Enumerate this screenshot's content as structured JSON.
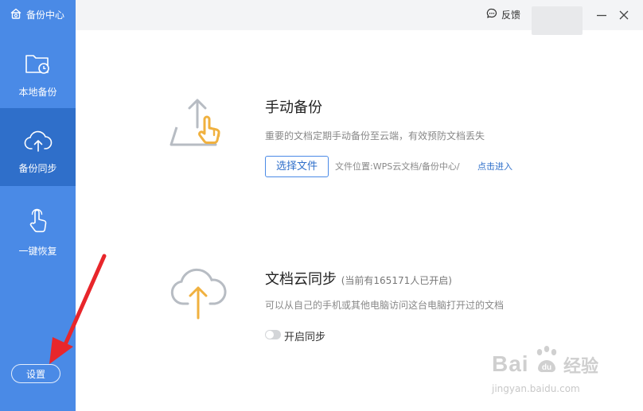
{
  "app": {
    "title": "备份中心"
  },
  "sidebar": {
    "items": [
      {
        "label": "本地备份",
        "icon": "folder-clock-icon"
      },
      {
        "label": "备份同步",
        "icon": "cloud-upload-icon",
        "active": true
      },
      {
        "label": "一键恢复",
        "icon": "hand-pointer-icon"
      }
    ],
    "settings_label": "设置"
  },
  "titlebar": {
    "feedback_label": "反馈"
  },
  "manual_backup": {
    "title": "手动备份",
    "description": "重要的文档定期手动备份至云端，有效预防文档丢失",
    "button_label": "选择文件",
    "file_location": "文件位置:WPS云文档/备份中心/",
    "enter_link": "点击进入"
  },
  "cloud_sync": {
    "title": "文档云同步",
    "user_count": "(当前有165171人已开启)",
    "description": "可以从自己的手机或其他电脑访问这台电脑打开过的文档",
    "toggle_label": "开启同步",
    "toggle_on": false
  },
  "watermark": {
    "brand": "Bai",
    "brand2": "经验",
    "url": "jingyan.baidu.com"
  },
  "colors": {
    "sidebar": "#4a8ae6",
    "sidebar_active": "#2f6fca",
    "accent_orange": "#f0b13f",
    "icon_gray": "#b7bcc3",
    "annotation_arrow": "#e8262b"
  }
}
